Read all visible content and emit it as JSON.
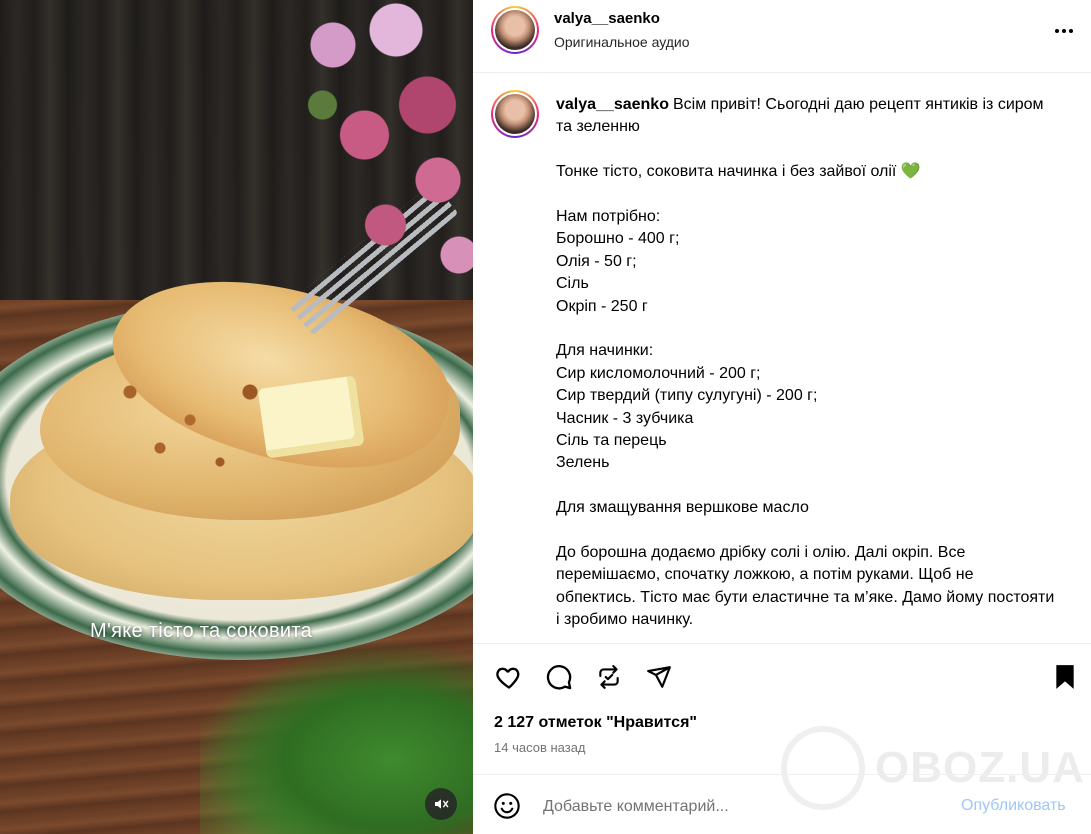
{
  "media": {
    "caption": "М'яке тісто та соковита",
    "mute_icon": "muted-speaker-icon"
  },
  "header": {
    "username": "valya__saenko",
    "subtitle": "Оригинальное аудио",
    "more_icon": "ellipsis-icon"
  },
  "post": {
    "author": "valya__saenko",
    "first_line": "Всім привіт! Сьогодні даю рецепт янтиків із сиром та зеленню",
    "blocks": [
      "Тонке тісто, соковита начинка і без зайвої олії 💚",
      "Нам потрібно:\nБорошно - 400 г;\nОлія - 50 г;\nСіль\nОкріп - 250 г",
      "Для начинки:\nСир кисломолочний - 200 г;\nСир твердий (типу сулугуні) - 200 г;\nЧасник - 3 зубчика\nСіль та перець\nЗелень",
      "Для змащування вершкове масло",
      "До борошна додаємо дрібку солі і олію. Далі окріп. Все перемішаємо, спочатку ложкою, а потім руками. Щоб не обпектись. Тісто має бути еластичне та м’яке. Дамо йому постояти і зробимо начинку."
    ]
  },
  "actions": {
    "likes": "2 127 отметок \"Нравится\"",
    "time": "14 часов назад",
    "icons": [
      "heart-icon",
      "comment-icon",
      "repost-icon",
      "share-icon",
      "bookmark-icon"
    ]
  },
  "watermark": {
    "text": "OBOZ.UA"
  },
  "comment_bar": {
    "placeholder": "Добавьте комментарий...",
    "publish": "Опубликовать"
  },
  "colors": {
    "publish_disabled": "#9fc7f7",
    "border": "#efefef",
    "muted_text": "#737373"
  }
}
